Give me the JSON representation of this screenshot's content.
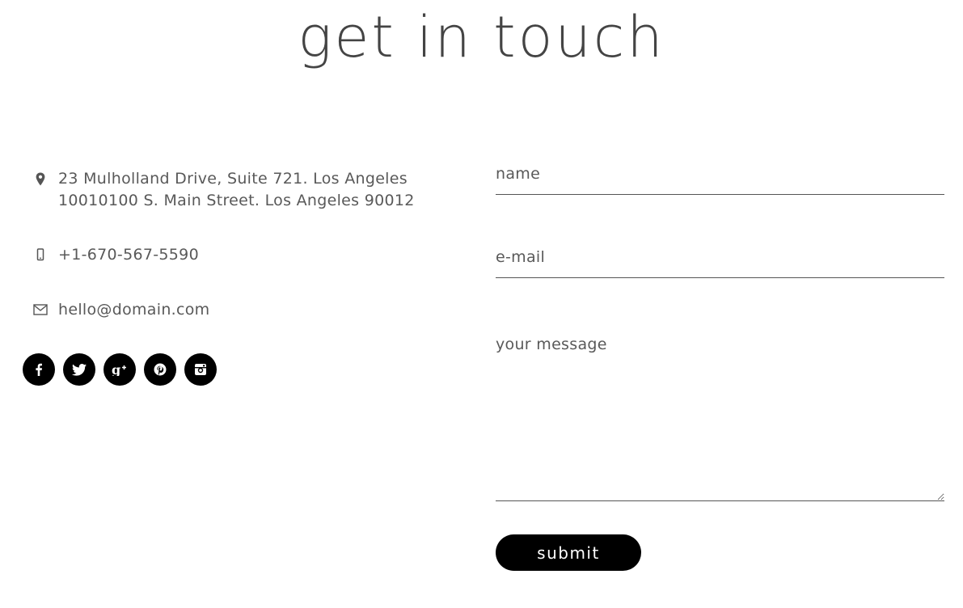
{
  "header": {
    "title": "get in touch"
  },
  "contact": {
    "address_line1": "23 Mulholland Drive, Suite 721. Los Angeles",
    "address_line2": "10010100 S. Main Street. Los Angeles 90012",
    "phone": "+1-670-567-5590",
    "email": "hello@domain.com",
    "icons": {
      "address": "map-pin-icon",
      "phone": "mobile-phone-icon",
      "email": "envelope-icon"
    }
  },
  "socials": [
    {
      "name": "facebook-icon",
      "glyph": "f"
    },
    {
      "name": "twitter-icon",
      "glyph": "t"
    },
    {
      "name": "google-plus-icon",
      "glyph": "g+"
    },
    {
      "name": "pinterest-icon",
      "glyph": "p"
    },
    {
      "name": "instagram-icon",
      "glyph": "ig"
    }
  ],
  "form": {
    "name_placeholder": "name",
    "email_placeholder": "e-mail",
    "message_placeholder": "your message",
    "submit_label": "submit"
  },
  "colors": {
    "accent": "#000000",
    "text": "#595959",
    "background": "#ffffff"
  }
}
